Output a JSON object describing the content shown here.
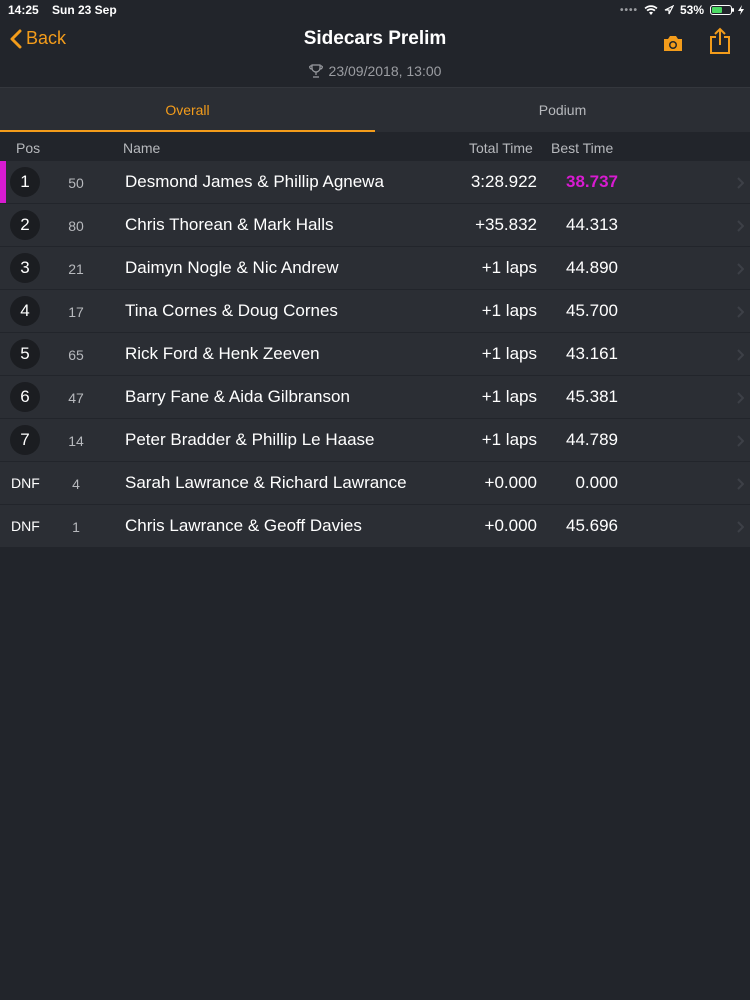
{
  "status": {
    "time": "14:25",
    "date": "Sun 23 Sep",
    "battery": "53%"
  },
  "nav": {
    "back_label": "Back",
    "title": "Sidecars Prelim",
    "subtitle": "23/09/2018, 13:00",
    "accent": "#f39c1b"
  },
  "tabs": [
    {
      "label": "Overall",
      "active": true
    },
    {
      "label": "Podium",
      "active": false
    }
  ],
  "columns": {
    "pos": "Pos",
    "name": "Name",
    "total": "Total Time",
    "best": "Best Time"
  },
  "rows": [
    {
      "pos": "1",
      "num": "50",
      "name": "Desmond James & Phillip Agnewa",
      "total": "3:28.922",
      "best": "38.737"
    },
    {
      "pos": "2",
      "num": "80",
      "name": "Chris Thorean & Mark Halls",
      "total": "+35.832",
      "best": "44.313"
    },
    {
      "pos": "3",
      "num": "21",
      "name": "Daimyn Nogle & Nic Andrew",
      "total": "+1 laps",
      "best": "44.890"
    },
    {
      "pos": "4",
      "num": "17",
      "name": "Tina Cornes & Doug Cornes",
      "total": "+1 laps",
      "best": "45.700"
    },
    {
      "pos": "5",
      "num": "65",
      "name": "Rick Ford & Henk Zeeven",
      "total": "+1 laps",
      "best": "43.161"
    },
    {
      "pos": "6",
      "num": "47",
      "name": "Barry Fane & Aida Gilbranson",
      "total": "+1 laps",
      "best": "45.381"
    },
    {
      "pos": "7",
      "num": "14",
      "name": "Peter Bradder & Phillip Le Haase",
      "total": "+1 laps",
      "best": "44.789"
    },
    {
      "pos": "DNF",
      "num": "4",
      "name": "Sarah Lawrance & Richard Lawrance",
      "total": "+0.000",
      "best": "0.000"
    },
    {
      "pos": "DNF",
      "num": "1",
      "name": "Chris Lawrance & Geoff Davies",
      "total": "+0.000",
      "best": "45.696"
    }
  ],
  "fastest_lap_color": "#d81bd1"
}
